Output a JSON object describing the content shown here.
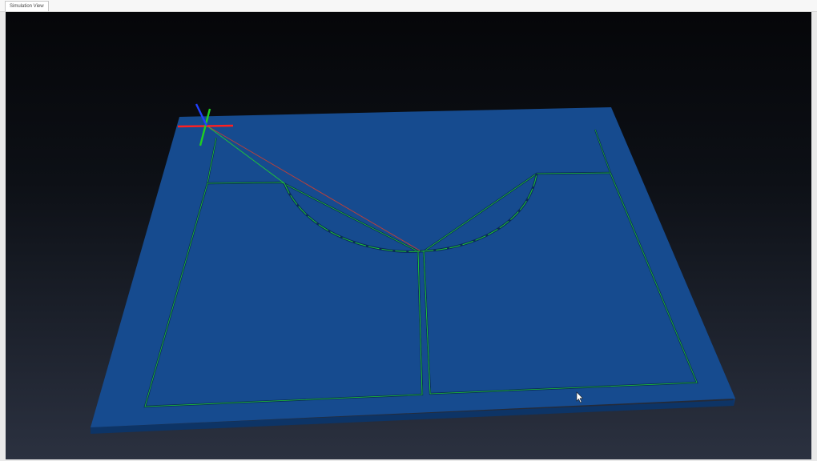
{
  "window": {
    "tab_label": "Simulation View"
  },
  "scene": {
    "background_top": "#050609",
    "background_bottom": "#2b3140",
    "stock_color": "#164b8f",
    "toolpath_color": "#1fc23a",
    "rapid_move_color": "#c23a3a",
    "axis_x_color": "#ff2020",
    "axis_y_color": "#20d020",
    "axis_z_color": "#2040ff",
    "cursor": "arrow-cursor"
  }
}
